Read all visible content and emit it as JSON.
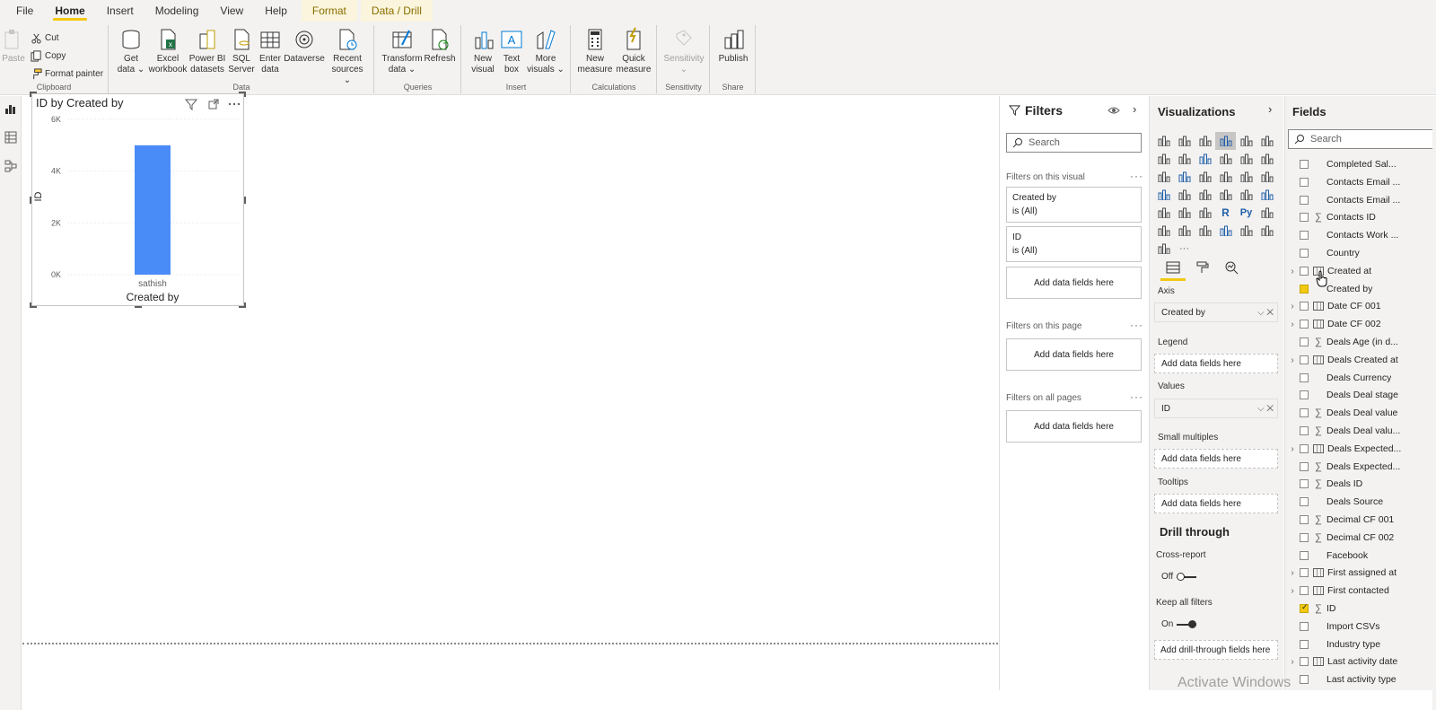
{
  "menu": {
    "items": [
      {
        "label": "File",
        "active": false,
        "contextual": false
      },
      {
        "label": "Home",
        "active": true,
        "contextual": false
      },
      {
        "label": "Insert",
        "active": false,
        "contextual": false
      },
      {
        "label": "Modeling",
        "active": false,
        "contextual": false
      },
      {
        "label": "View",
        "active": false,
        "contextual": false
      },
      {
        "label": "Help",
        "active": false,
        "contextual": false
      },
      {
        "label": "Format",
        "active": false,
        "contextual": true
      },
      {
        "label": "Data / Drill",
        "active": false,
        "contextual": true
      }
    ]
  },
  "ribbon": {
    "clipboard": {
      "label": "Clipboard",
      "paste": "Paste",
      "cut": "Cut",
      "copy": "Copy",
      "format_painter": "Format painter"
    },
    "data": {
      "label": "Data",
      "get_data": "Get data ⌄",
      "excel": "Excel workbook",
      "pbi_datasets": "Power BI datasets",
      "sql": "SQL Server",
      "enter_data": "Enter data",
      "dataverse": "Dataverse",
      "recent": "Recent sources ⌄"
    },
    "queries": {
      "label": "Queries",
      "transform": "Transform data ⌄",
      "refresh": "Refresh"
    },
    "insert": {
      "label": "Insert",
      "new_visual": "New visual",
      "text_box": "Text box",
      "more_visuals": "More visuals ⌄"
    },
    "calculations": {
      "label": "Calculations",
      "new_measure": "New measure",
      "quick_measure": "Quick measure"
    },
    "sensitivity": {
      "label": "Sensitivity",
      "button": "Sensitivity ⌄"
    },
    "share": {
      "label": "Share",
      "publish": "Publish"
    }
  },
  "visual": {
    "title": "ID by Created by"
  },
  "chart_data": {
    "type": "bar",
    "title": "ID by Created by",
    "categories": [
      "sathish"
    ],
    "values": [
      5000
    ],
    "xlabel": "Created by",
    "ylabel": "ID",
    "ylim": [
      0,
      6000
    ],
    "yticks": [
      "0K",
      "2K",
      "4K",
      "6K"
    ],
    "ytick_values": [
      0,
      2000,
      4000,
      6000
    ],
    "bar_color": "#4a8cf7",
    "grid": true
  },
  "filters": {
    "title": "Filters",
    "search_placeholder": "Search",
    "on_visual_label": "Filters on this visual",
    "cards": [
      {
        "field": "Created by",
        "state": "is (All)"
      },
      {
        "field": "ID",
        "state": "is (All)"
      }
    ],
    "add_fields": "Add data fields here",
    "on_page_label": "Filters on this page",
    "on_all_label": "Filters on all pages"
  },
  "visualizations": {
    "title": "Visualizations",
    "axis_label": "Axis",
    "axis_value": "Created by",
    "legend_label": "Legend",
    "values_label": "Values",
    "values_value": "ID",
    "small_multiples_label": "Small multiples",
    "tooltips_label": "Tooltips",
    "add_fields": "Add data fields here",
    "drill_title": "Drill through",
    "cross_report_label": "Cross-report",
    "cross_report_state": "Off",
    "keep_filters_label": "Keep all filters",
    "keep_filters_state": "On",
    "add_drill_fields": "Add drill-through fields here",
    "accent": "#f2c811"
  },
  "fields": {
    "title": "Fields",
    "search_placeholder": "Search",
    "items": [
      {
        "name": "Completed Sal...",
        "type": "text",
        "expand": false,
        "checked": false
      },
      {
        "name": "Contacts Email ...",
        "type": "text",
        "expand": false,
        "checked": false
      },
      {
        "name": "Contacts Email ...",
        "type": "text",
        "expand": false,
        "checked": false
      },
      {
        "name": "Contacts ID",
        "type": "sum",
        "expand": false,
        "checked": false
      },
      {
        "name": "Contacts Work ...",
        "type": "text",
        "expand": false,
        "checked": false
      },
      {
        "name": "Country",
        "type": "text",
        "expand": false,
        "checked": false
      },
      {
        "name": "Created at",
        "type": "date",
        "expand": true,
        "checked": false
      },
      {
        "name": "Created by",
        "type": "text",
        "expand": false,
        "checked": true
      },
      {
        "name": "Date CF 001",
        "type": "date",
        "expand": true,
        "checked": false
      },
      {
        "name": "Date CF 002",
        "type": "date",
        "expand": true,
        "checked": false
      },
      {
        "name": "Deals Age (in d...",
        "type": "sum",
        "expand": false,
        "checked": false
      },
      {
        "name": "Deals Created at",
        "type": "date",
        "expand": true,
        "checked": false
      },
      {
        "name": "Deals Currency",
        "type": "text",
        "expand": false,
        "checked": false
      },
      {
        "name": "Deals Deal stage",
        "type": "text",
        "expand": false,
        "checked": false
      },
      {
        "name": "Deals Deal value",
        "type": "sum",
        "expand": false,
        "checked": false
      },
      {
        "name": "Deals Deal valu...",
        "type": "sum",
        "expand": false,
        "checked": false
      },
      {
        "name": "Deals Expected...",
        "type": "date",
        "expand": true,
        "checked": false
      },
      {
        "name": "Deals Expected...",
        "type": "sum",
        "expand": false,
        "checked": false
      },
      {
        "name": "Deals ID",
        "type": "sum",
        "expand": false,
        "checked": false
      },
      {
        "name": "Deals Source",
        "type": "text",
        "expand": false,
        "checked": false
      },
      {
        "name": "Decimal CF 001",
        "type": "sum",
        "expand": false,
        "checked": false
      },
      {
        "name": "Decimal CF 002",
        "type": "sum",
        "expand": false,
        "checked": false
      },
      {
        "name": "Facebook",
        "type": "text",
        "expand": false,
        "checked": false
      },
      {
        "name": "First assigned at",
        "type": "date",
        "expand": true,
        "checked": false
      },
      {
        "name": "First contacted",
        "type": "date",
        "expand": true,
        "checked": false
      },
      {
        "name": "ID",
        "type": "sum",
        "expand": false,
        "checked": true
      },
      {
        "name": "Import CSVs",
        "type": "text",
        "expand": false,
        "checked": false
      },
      {
        "name": "Industry type",
        "type": "text",
        "expand": false,
        "checked": false
      },
      {
        "name": "Last activity date",
        "type": "date",
        "expand": true,
        "checked": false
      },
      {
        "name": "Last activity type",
        "type": "text",
        "expand": false,
        "checked": false
      }
    ]
  },
  "watermark": "Activate Windows"
}
